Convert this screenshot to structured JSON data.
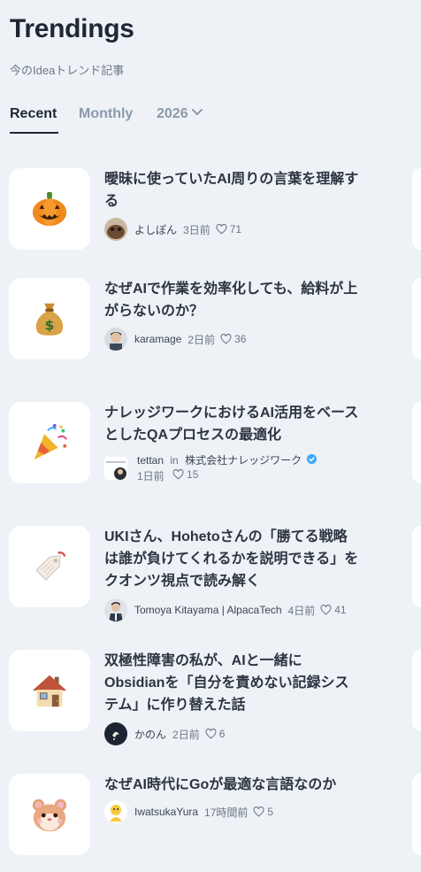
{
  "header": {
    "title": "Trendings",
    "subtitle": "今のIdeaトレンド記事"
  },
  "tabs": [
    {
      "label": "Recent",
      "active": true
    },
    {
      "label": "Monthly",
      "active": false
    },
    {
      "label": "2026",
      "active": false
    }
  ],
  "articles": [
    {
      "emoji_icon": "jack-o-lantern-icon",
      "title": "曖昧に使っていたAI周りの言葉を理解する",
      "author": "よしぽん",
      "date": "3日前",
      "likes": "71"
    },
    {
      "emoji_icon": "money-bag-icon",
      "title": "なぜAIで作業を効率化しても、給料が上がらないのか？",
      "author": "karamage",
      "date": "2日前",
      "likes": "36"
    },
    {
      "emoji_icon": "party-popper-icon",
      "title": "ナレッジワークにおけるAI活用をベースとしたQAプロセスの最適化",
      "author": "tettan",
      "publication_in": "in",
      "publication": "株式会社ナレッジワーク",
      "date": "1日前",
      "likes": "15"
    },
    {
      "emoji_icon": "tag-icon",
      "title": "UKIさん、Hohetoさんの「勝てる戦略は誰が負けてくれるかを説明できる」をクオンツ視点で読み解く",
      "author": "Tomoya Kitayama | AlpacaTech",
      "date": "4日前",
      "likes": "41"
    },
    {
      "emoji_icon": "house-icon",
      "title": "双極性障害の私が、AIと一緒にObsidianを「自分を責めない記録システム」に作り替えた話",
      "author": "かのん",
      "date": "2日前",
      "likes": "6"
    },
    {
      "emoji_icon": "hamster-icon",
      "title": "なぜAI時代にGoが最適な言語なのか",
      "author": "IwatsukaYura",
      "date": "17時間前",
      "likes": "5"
    }
  ],
  "colors": {
    "background": "#eef2f7",
    "card": "#ffffff",
    "text_primary": "#1e2734",
    "text_muted": "#8c99a8",
    "verified": "#3ea8ff"
  }
}
